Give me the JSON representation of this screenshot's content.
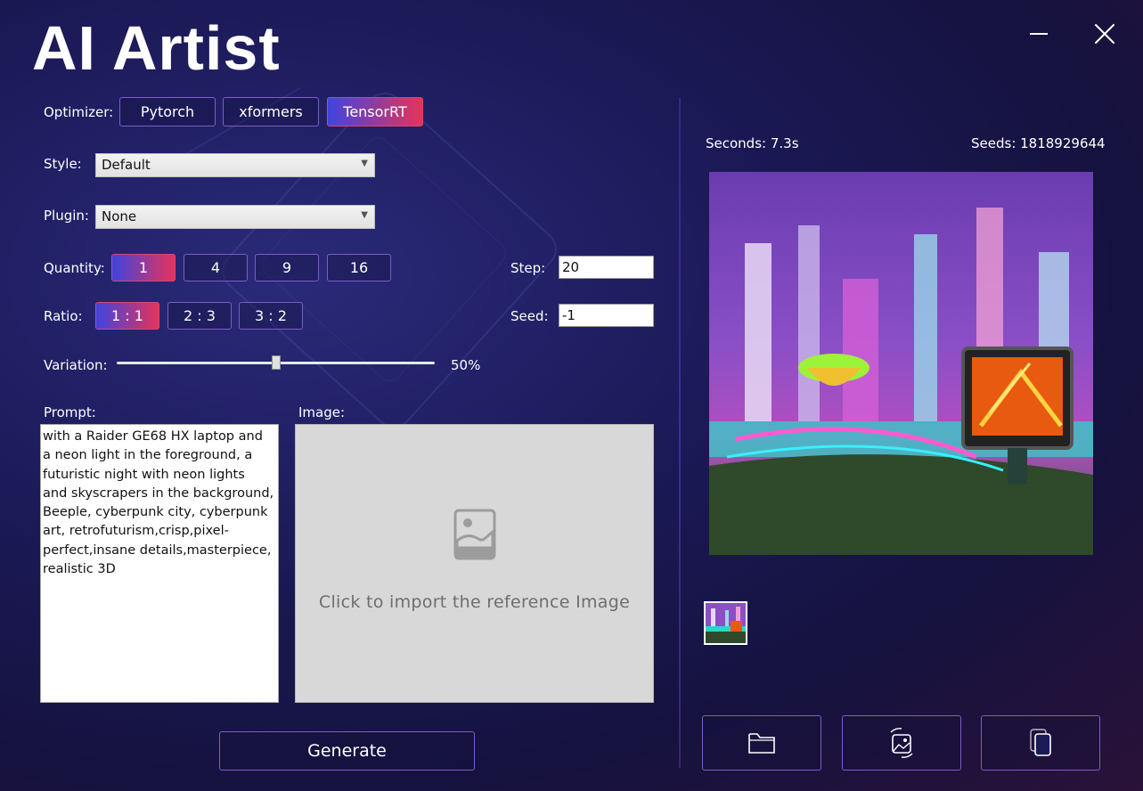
{
  "app": {
    "title": "AI Artist"
  },
  "optimizer": {
    "label": "Optimizer:",
    "options": [
      "Pytorch",
      "xformers",
      "TensorRT"
    ],
    "selected": "TensorRT"
  },
  "style": {
    "label": "Style:",
    "value": "Default"
  },
  "plugin": {
    "label": "Plugin:",
    "value": "None"
  },
  "quantity": {
    "label": "Quantity:",
    "options": [
      "1",
      "4",
      "9",
      "16"
    ],
    "selected": "1"
  },
  "ratio": {
    "label": "Ratio:",
    "options": [
      "1 : 1",
      "2 : 3",
      "3 : 2"
    ],
    "selected": "1 : 1"
  },
  "step": {
    "label": "Step:",
    "value": "20"
  },
  "seed": {
    "label": "Seed:",
    "value": "-1"
  },
  "variation": {
    "label": "Variation:",
    "value_text": "50%",
    "value": 0.5
  },
  "prompt": {
    "label": "Prompt:",
    "text": "with a Raider GE68 HX laptop and\na neon light in the foreground, a\nfuturistic night with neon lights\nand skyscrapers in the background,\nBeeple, cyberpunk city, cyberpunk\nart, retrofuturism,crisp,pixel-\nperfect,insane details,masterpiece,\nrealistic 3D"
  },
  "image": {
    "label": "Image:",
    "placeholder": "Click to import the reference Image",
    "icon": "image-placeholder-icon"
  },
  "generate": {
    "label": "Generate"
  },
  "result": {
    "seconds": "Seconds: 7.3s",
    "seeds": "Seeds: 1818929644"
  },
  "actions": {
    "icons": [
      "folder-icon",
      "image-swap-icon",
      "copy-icon"
    ]
  },
  "colors": {
    "accent_start": "#3f44e0",
    "accent_end": "#e5335a",
    "border": "#7e5cc9",
    "background": "#1b1956"
  }
}
